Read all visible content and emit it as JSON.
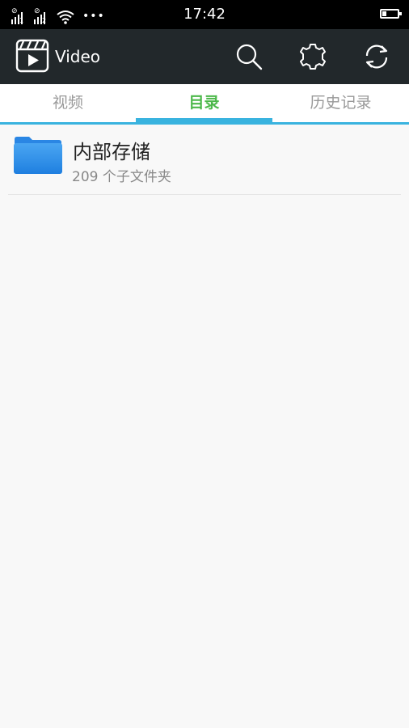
{
  "status_bar": {
    "sim1_slot": "1",
    "sim2_slot": "2",
    "more_indicator": "•••",
    "time": "17:42"
  },
  "app_bar": {
    "title": "Video",
    "actions": [
      "search-icon",
      "settings-gear-icon",
      "refresh-icon"
    ]
  },
  "tabs": [
    {
      "label": "视频",
      "selected": false
    },
    {
      "label": "目录",
      "selected": true
    },
    {
      "label": "历史记录",
      "selected": false
    }
  ],
  "directory": [
    {
      "name": "内部存储",
      "subtitle": "209 个子文件夹",
      "icon": "folder-icon"
    }
  ],
  "colors": {
    "app_bar": "#22282b",
    "tab_accent": "#39b3df",
    "selected_tab_text": "#4cb84a",
    "folder": "#2f8ee8"
  }
}
